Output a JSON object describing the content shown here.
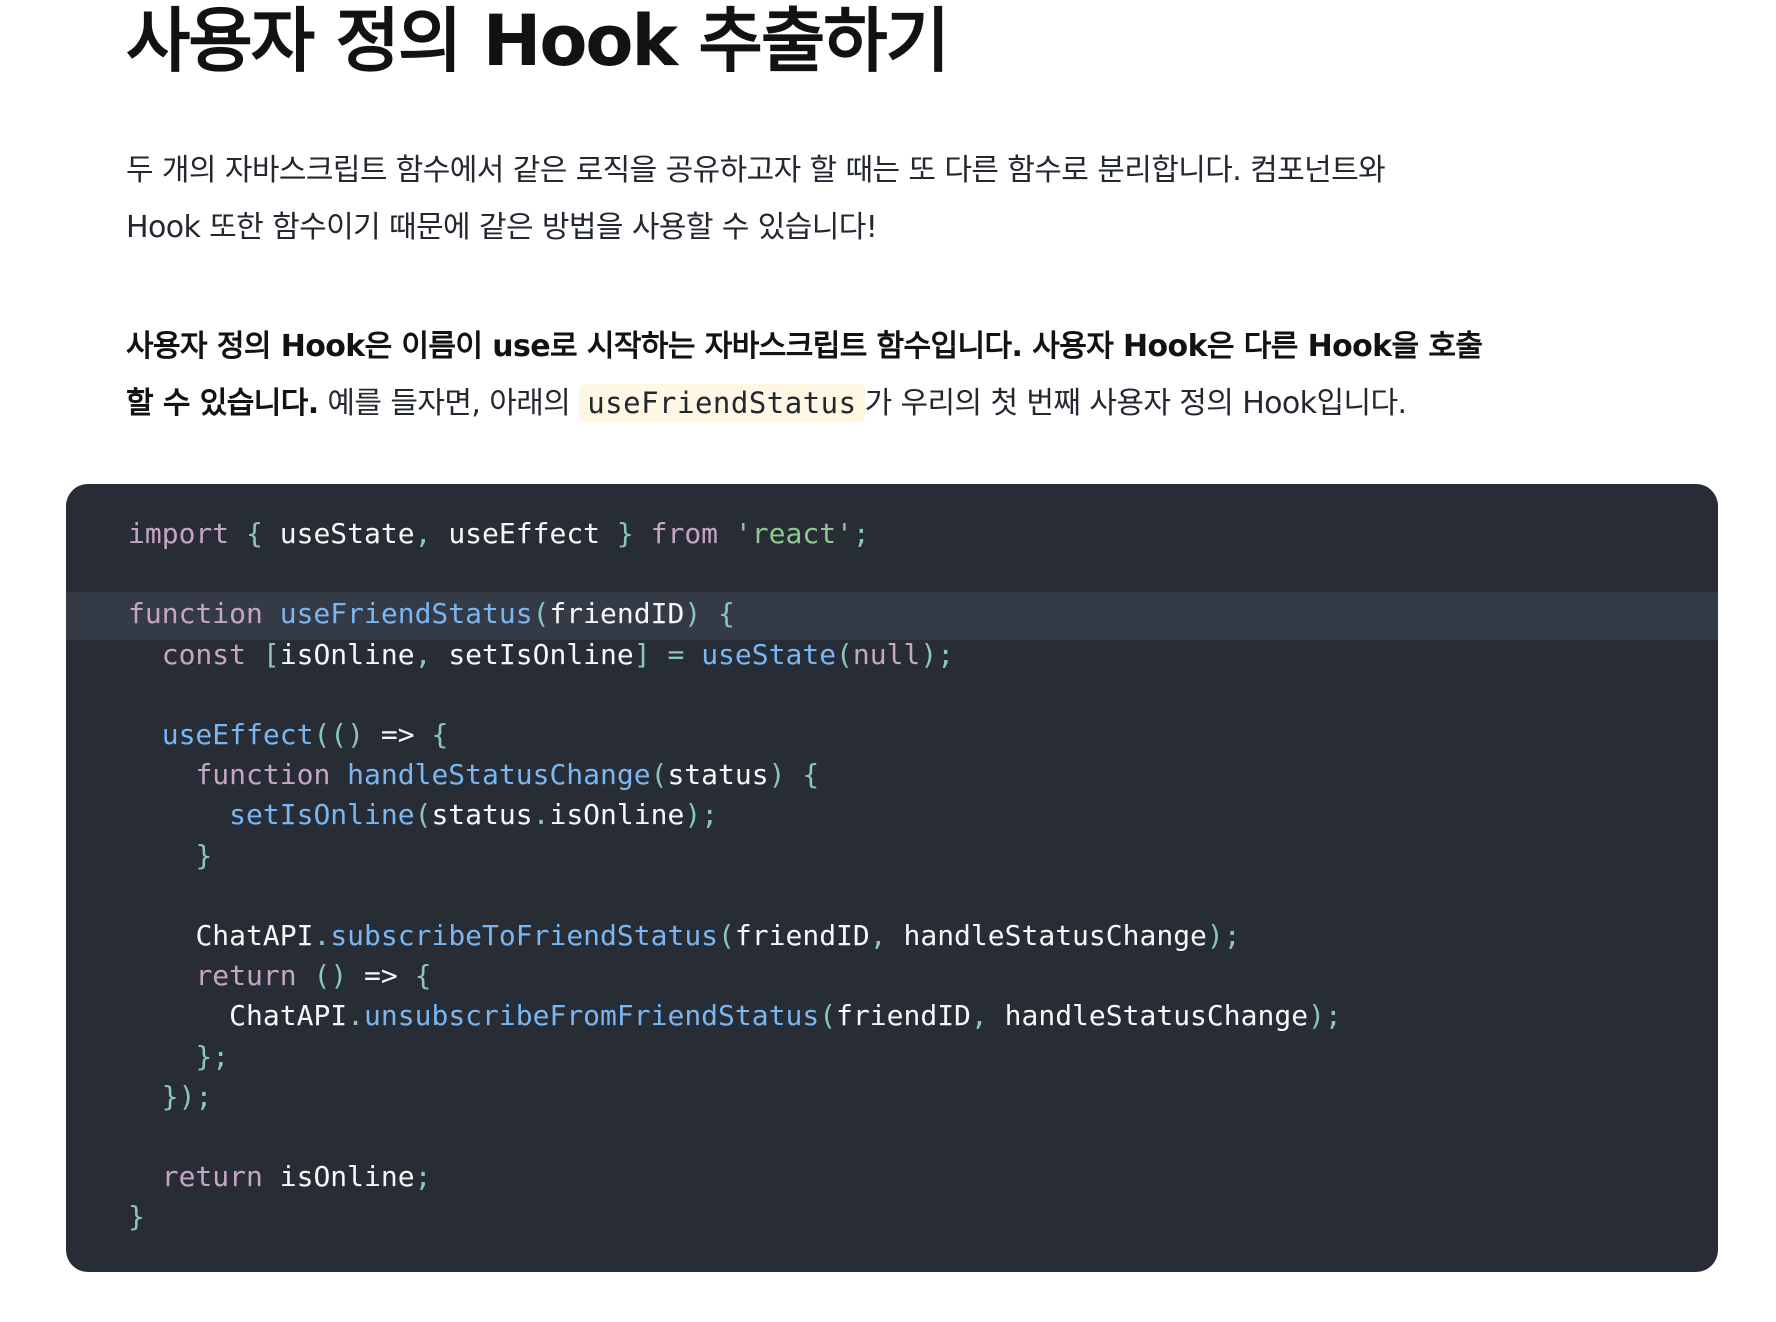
{
  "heading": {
    "title": "사용자 정의 Hook 추출하기"
  },
  "paragraph1": {
    "line1": "두 개의 자바스크립트 함수에서 같은 로직을 공유하고자 할 때는 또 다른 함수로 분리합니다. 컴포넌트와",
    "line2": "Hook 또한 함수이기 때문에 같은 방법을 사용할 수 있습니다!"
  },
  "paragraph2": {
    "bold_line1": "사용자 정의 Hook은 이름이 use로 시작하는 자바스크립트 함수입니다. 사용자 Hook은 다른 Hook을 호출",
    "bold_line2": "할 수 있습니다.",
    "text_before_code": " 예를 들자면, 아래의 ",
    "inline_code": "useFriendStatus",
    "text_after_code": "가 우리의 첫 번째 사용자 정의 Hook입니다."
  },
  "code": {
    "language": "javascript",
    "highlighted_line": 3,
    "lines": [
      "import { useState, useEffect } from 'react';",
      "",
      "function useFriendStatus(friendID) {",
      "  const [isOnline, setIsOnline] = useState(null);",
      "",
      "  useEffect(() => {",
      "    function handleStatusChange(status) {",
      "      setIsOnline(status.isOnline);",
      "    }",
      "",
      "    ChatAPI.subscribeToFriendStatus(friendID, handleStatusChange);",
      "    return () => {",
      "      ChatAPI.unsubscribeFromFriendStatus(friendID, handleStatusChange);",
      "    };",
      "  });",
      "",
      "  return isOnline;",
      "}"
    ]
  },
  "colors": {
    "code_background": "#282c34",
    "code_highlight_line": "#343a46",
    "keyword": "#c5a5c5",
    "function_name": "#79b6f2",
    "string": "#8dc891",
    "punctuation": "#88c6be",
    "identifier": "#f6f7f9",
    "inline_code_background": "#fdf7e4"
  }
}
